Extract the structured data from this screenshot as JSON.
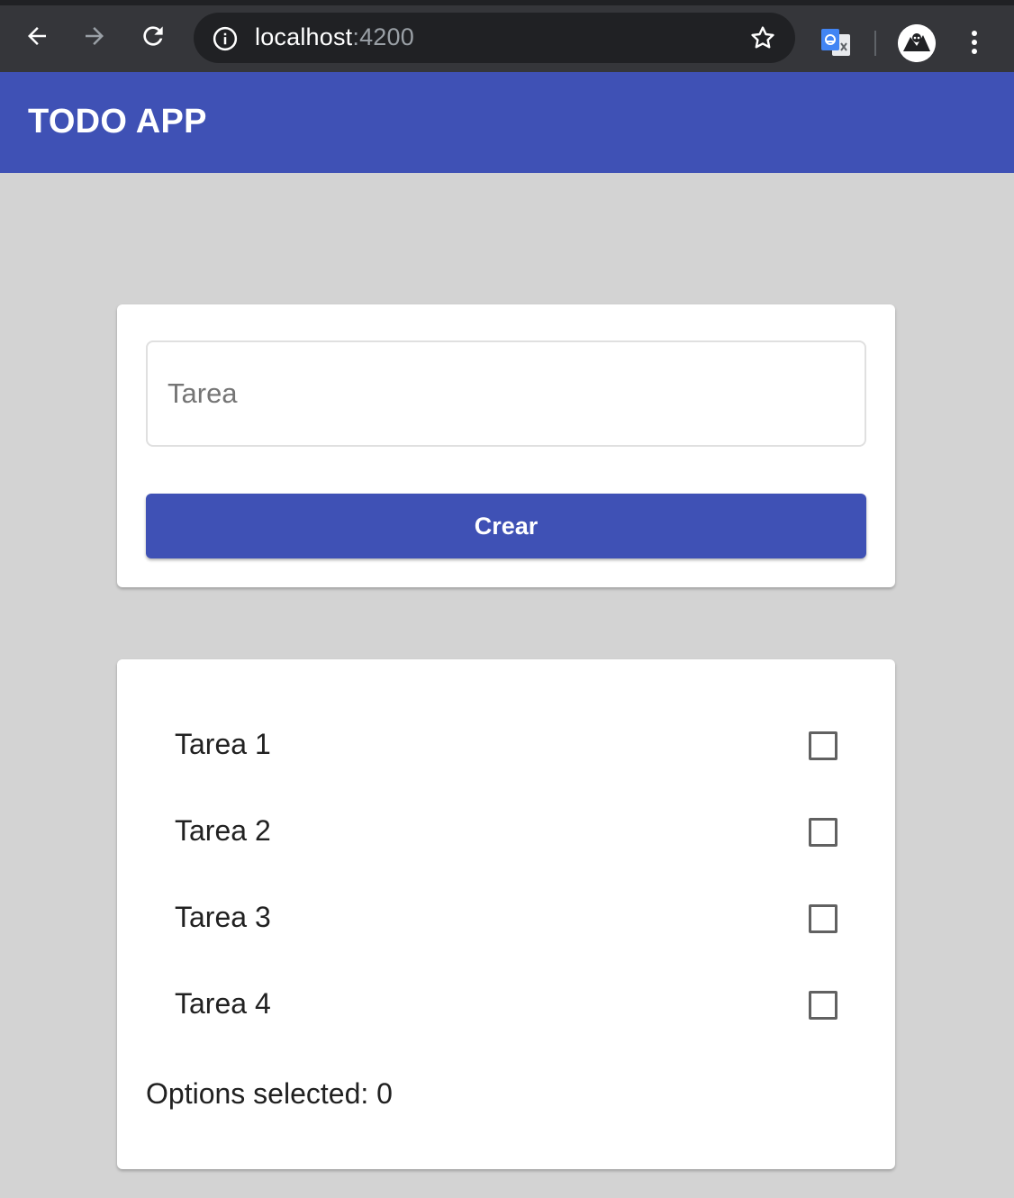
{
  "browser": {
    "url_host": "localhost",
    "url_port": ":4200"
  },
  "app": {
    "title": "TODO APP"
  },
  "form": {
    "input_placeholder": "Tarea",
    "input_value": "",
    "submit_label": "Crear"
  },
  "tasks": [
    {
      "label": "Tarea 1",
      "checked": false
    },
    {
      "label": "Tarea 2",
      "checked": false
    },
    {
      "label": "Tarea 3",
      "checked": false
    },
    {
      "label": "Tarea 4",
      "checked": false
    }
  ],
  "summary": {
    "text": "Options selected: 0"
  },
  "colors": {
    "primary": "#3f51b5",
    "page_background": "#d3d3d3",
    "browser_frame": "#35363a"
  }
}
